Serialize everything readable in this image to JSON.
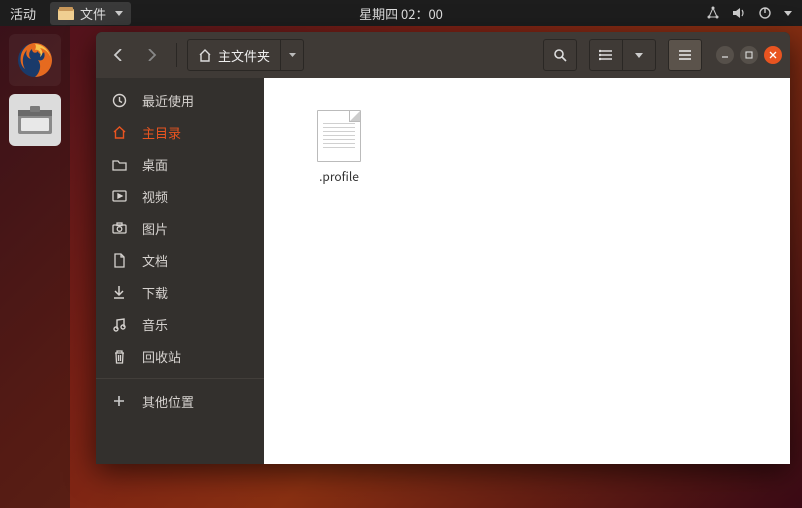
{
  "topbar": {
    "activities": "活动",
    "app_indicator": "文件",
    "clock": "星期四 02：00"
  },
  "window": {
    "breadcrumb": "主文件夹"
  },
  "sidebar": {
    "items": [
      {
        "icon": "clock",
        "label": "最近使用"
      },
      {
        "icon": "home",
        "label": "主目录"
      },
      {
        "icon": "folder",
        "label": "桌面"
      },
      {
        "icon": "video",
        "label": "视频"
      },
      {
        "icon": "camera",
        "label": "图片"
      },
      {
        "icon": "doc",
        "label": "文档"
      },
      {
        "icon": "download",
        "label": "下载"
      },
      {
        "icon": "music",
        "label": "音乐"
      },
      {
        "icon": "trash",
        "label": "回收站"
      }
    ],
    "other": "其他位置"
  },
  "files": [
    {
      "name": ".profile"
    }
  ]
}
